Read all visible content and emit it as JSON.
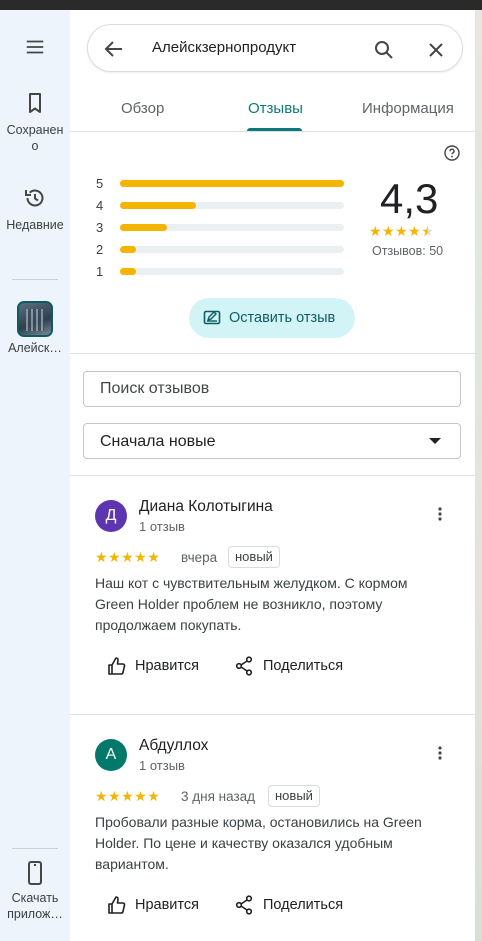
{
  "rail": {
    "menu_icon": "menu-icon",
    "saved_label": "Сохранено",
    "recent_label": "Недавние",
    "place_label": "Алейск…",
    "app_label": "Скачать прилож…"
  },
  "search": {
    "query": "Алейскзернопродукт",
    "icons": [
      "back-arrow-icon",
      "search-icon",
      "close-icon"
    ]
  },
  "tabs": [
    "Обзор",
    "Отзывы",
    "Информация"
  ],
  "active_tab": "Отзывы",
  "ratings": {
    "average": "4,3",
    "count_label": "Отзывов: 50",
    "distribution": [
      {
        "stars": "5",
        "fraction": 1.0
      },
      {
        "stars": "4",
        "fraction": 0.34
      },
      {
        "stars": "3",
        "fraction": 0.21
      },
      {
        "stars": "2",
        "fraction": 0.07
      },
      {
        "stars": "1",
        "fraction": 0.07
      }
    ]
  },
  "write_review_label": "Оставить отзыв",
  "review_search_placeholder": "Поиск отзывов",
  "sort_label": "Сначала новые",
  "reviews": [
    {
      "initial": "Д",
      "avatar_color": "#5e35b1",
      "name": "Диана Колотыгина",
      "sub": "1 отзыв",
      "rating": 5,
      "time": "вчера",
      "badge": "новый",
      "text": "Наш кот с чувствительным желудком. С кормом Green Holder проблем не возникло, поэтому продолжаем покупать.",
      "like_label": "Нравится",
      "share_label": "Поделиться"
    },
    {
      "initial": "А",
      "avatar_color": "#00796b",
      "name": "Абдуллох",
      "sub": "1 отзыв",
      "rating": 5,
      "time": "3 дня назад",
      "badge": "новый",
      "text": "Пробовали разные корма, остановились на Green Holder. По цене и качеству оказался удобным вариантом.",
      "like_label": "Нравится",
      "share_label": "Поделиться"
    }
  ],
  "colors": {
    "accent": "#0b7a7a",
    "star": "#f4b400",
    "rail_bg": "#eef4fb"
  }
}
